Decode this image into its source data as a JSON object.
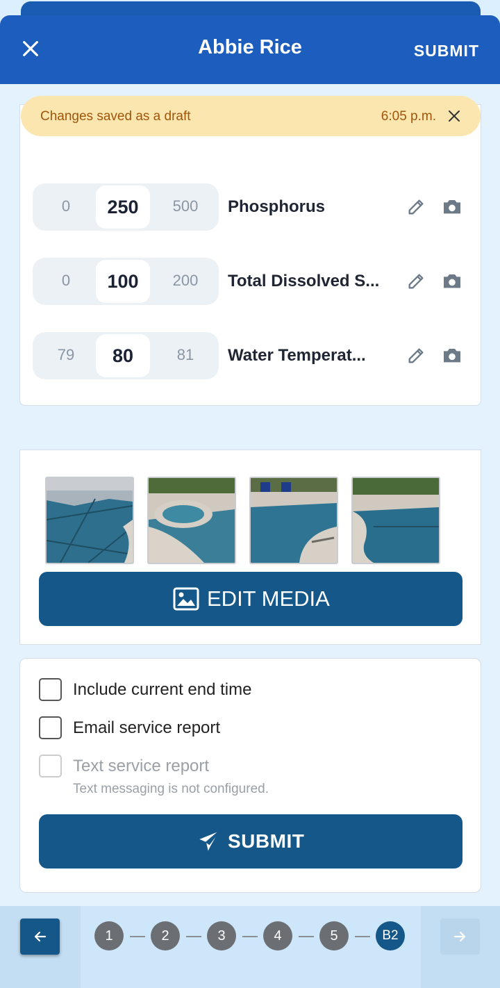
{
  "header": {
    "title": "Abbie Rice",
    "submit_label": "SUBMIT"
  },
  "toast": {
    "message": "Changes saved as a draft",
    "time": "6:05 p.m."
  },
  "readings": [
    {
      "low": "0",
      "value": "250",
      "high": "500",
      "label": "Phosphorus"
    },
    {
      "low": "0",
      "value": "100",
      "high": "200",
      "label": "Total Dissolved S..."
    },
    {
      "low": "79",
      "value": "80",
      "high": "81",
      "label": "Water Temperat..."
    }
  ],
  "media": {
    "photo_count": 4,
    "edit_label": "EDIT MEDIA"
  },
  "options": {
    "items": [
      {
        "label": "Include current end time",
        "checked": false,
        "disabled": false
      },
      {
        "label": "Email service report",
        "checked": false,
        "disabled": false
      },
      {
        "label": "Text service report",
        "checked": false,
        "disabled": true
      }
    ],
    "note": "Text messaging is not configured.",
    "submit_label": "SUBMIT"
  },
  "nav": {
    "back_arrow": "←",
    "next_arrow": "→",
    "steps": [
      "1",
      "2",
      "3",
      "4",
      "5",
      "B2"
    ],
    "active_step": "B2"
  },
  "colors": {
    "header_blue": "#1c5dbd",
    "button_blue": "#155788",
    "toast_bg": "#fbe6b0",
    "toast_text": "#a0560a"
  }
}
